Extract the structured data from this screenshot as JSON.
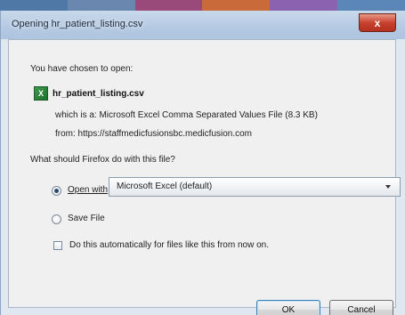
{
  "dialog": {
    "title": "Opening hr_patient_listing.csv",
    "close_glyph": "x"
  },
  "content": {
    "intro": "You have chosen to open:",
    "file_icon_glyph": "X",
    "file_name": "hr_patient_listing.csv",
    "which_is": "which is a: Microsoft Excel Comma Separated Values File (8.3 KB)",
    "from": "from: https://staffmedicfusionsbc.medicfusion.com",
    "question": "What should Firefox do with this file?"
  },
  "options": {
    "open_with_label": "Open with",
    "open_with_selected": true,
    "app_select_value": "Microsoft Excel (default)",
    "save_file_label": "Save File",
    "save_file_selected": false,
    "auto_label": "Do this automatically for files like this from now on.",
    "auto_checked": false
  },
  "buttons": {
    "ok": "OK",
    "cancel": "Cancel"
  },
  "colors": {
    "titlebar": "#b4c9e2",
    "close_button": "#c8412e",
    "dialog_bg": "#f0f0f0"
  }
}
